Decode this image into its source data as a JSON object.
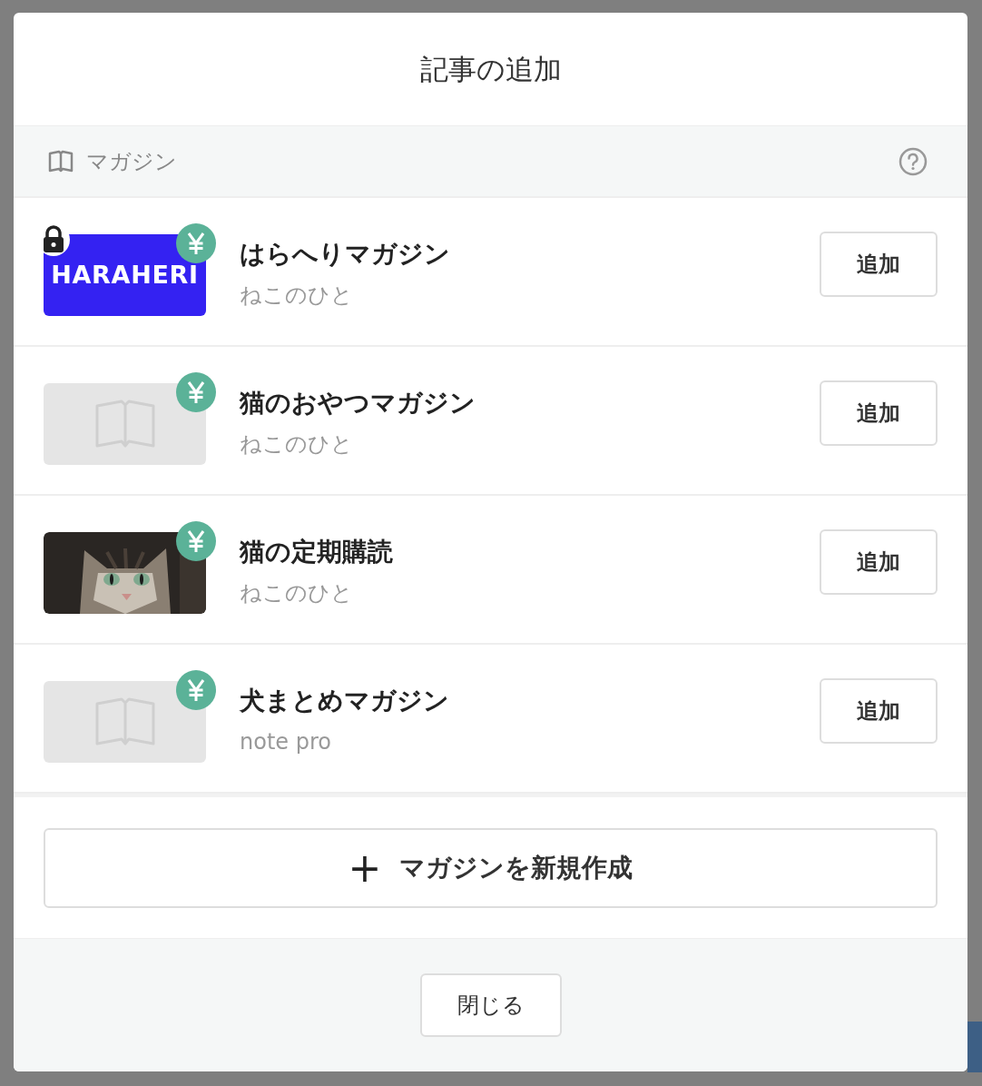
{
  "dialog": {
    "title": "記事の追加"
  },
  "section": {
    "label": "マガジン"
  },
  "magazines": [
    {
      "title": "はらへりマガジン",
      "author": "ねこのひと",
      "thumbnail": {
        "kind": "cover",
        "text": "HARAHERI"
      },
      "locked": true,
      "paid": true,
      "button": "追加"
    },
    {
      "title": "猫のおやつマガジン",
      "author": "ねこのひと",
      "thumbnail": {
        "kind": "empty"
      },
      "locked": false,
      "paid": true,
      "button": "追加"
    },
    {
      "title": "猫の定期購読",
      "author": "ねこのひと",
      "locked": false,
      "paid": true,
      "button": "追加"
    },
    {
      "title": "犬まとめマガジン",
      "author": "note pro",
      "thumbnail": {
        "kind": "empty"
      },
      "locked": false,
      "paid": true,
      "button": "追加"
    }
  ],
  "create_button": {
    "icon": "+",
    "label": "マガジンを新規作成"
  },
  "close_button": "閉じる"
}
